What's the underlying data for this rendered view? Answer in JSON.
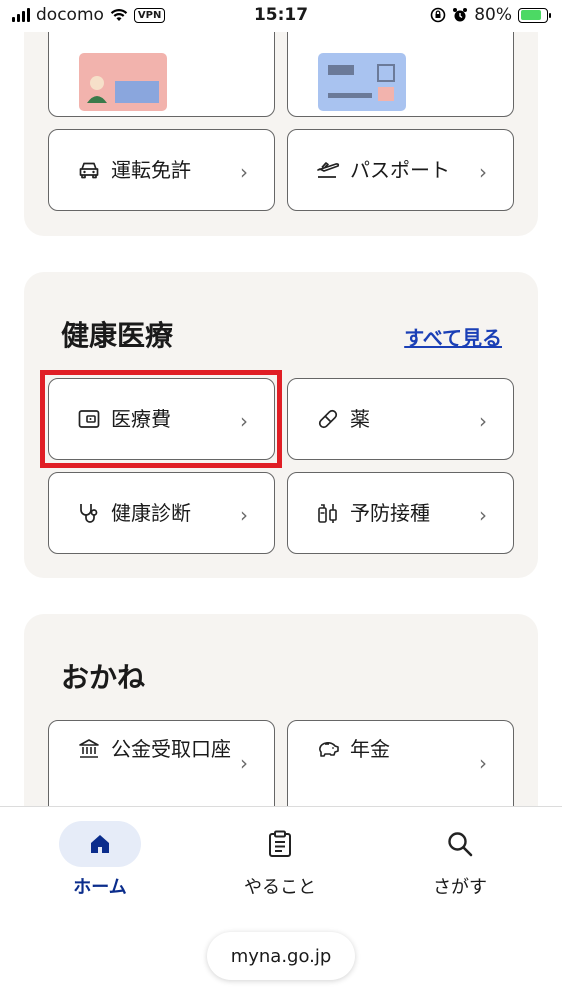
{
  "status_bar": {
    "carrier": "docomo",
    "vpn": "VPN",
    "time": "15:17",
    "battery_percent": "80%",
    "battery_level": 0.8
  },
  "top_section": {
    "cards": [
      {
        "label": "運転免許",
        "icon": "car-icon"
      },
      {
        "label": "パスポート",
        "icon": "airplane-icon"
      }
    ]
  },
  "health_section": {
    "title": "健康医療",
    "see_all": "すべて見る",
    "cards": [
      {
        "label": "医療費",
        "icon": "wallet-icon"
      },
      {
        "label": "薬",
        "icon": "pill-icon"
      },
      {
        "label": "健康診断",
        "icon": "stethoscope-icon"
      },
      {
        "label": "予防接種",
        "icon": "vaccine-icon"
      }
    ]
  },
  "money_section": {
    "title": "おかね",
    "cards": [
      {
        "label": "公金受取口座",
        "icon": "bank-icon"
      },
      {
        "label": "年金",
        "icon": "piggy-bank-icon"
      }
    ]
  },
  "bottom_nav": {
    "items": [
      {
        "label": "ホーム",
        "icon": "home-icon",
        "active": true
      },
      {
        "label": "やること",
        "icon": "clipboard-icon",
        "active": false
      },
      {
        "label": "さがす",
        "icon": "search-icon",
        "active": false
      }
    ]
  },
  "browser": {
    "url": "myna.go.jp"
  },
  "colors": {
    "accent": "#0b2d8c",
    "link": "#1a3fb6",
    "highlight": "#e01e25",
    "section_bg": "#f6f4f1"
  }
}
